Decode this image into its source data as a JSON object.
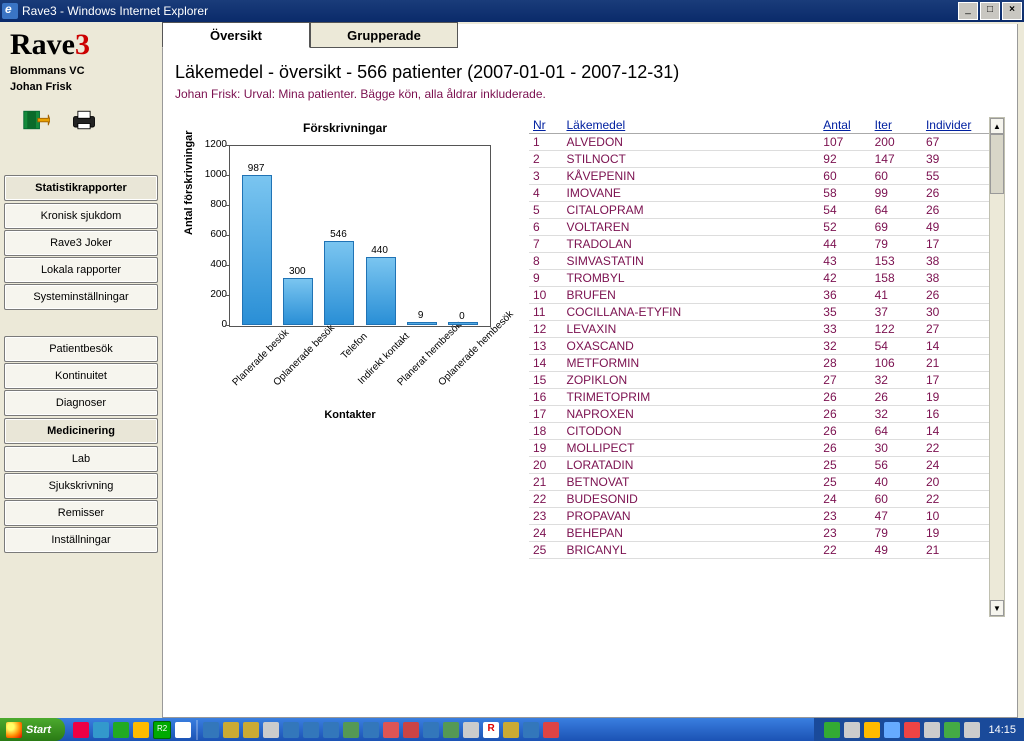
{
  "window": {
    "title": "Rave3 - Windows Internet Explorer"
  },
  "app": {
    "name_plain": "Rave",
    "name_accent": "3",
    "org": "Blommans VC",
    "user": "Johan Frisk"
  },
  "sidebar": {
    "section1_head": "Statistikrapporter",
    "section1": [
      "Kronisk sjukdom",
      "Rave3 Joker",
      "Lokala rapporter",
      "Systeminställningar"
    ],
    "section2": [
      "Patientbesök",
      "Kontinuitet",
      "Diagnoser"
    ],
    "section2_active": "Medicinering",
    "section3": [
      "Lab",
      "Sjukskrivning",
      "Remisser",
      "Inställningar"
    ]
  },
  "tabs": {
    "active": "Översikt",
    "other": "Grupperade"
  },
  "header": {
    "title": "Läkemedel - översikt - 566 patienter (2007-01-01 - 2007-12-31)",
    "subtitle": "Johan Frisk: Urval: Mina patienter. Bägge kön, alla åldrar inkluderade."
  },
  "chart_title": "Förskrivningar",
  "chart_data": {
    "type": "bar",
    "title": "Förskrivningar",
    "xlabel": "Kontakter",
    "ylabel": "Antal förskrivningar",
    "ylim": [
      0,
      1200
    ],
    "yticks": [
      0,
      200,
      400,
      600,
      800,
      1000,
      1200
    ],
    "categories": [
      "Planerade besök",
      "Oplanerade besök",
      "Telefon",
      "Indirekt kontakt",
      "Planerat hembesök",
      "Oplanerade hembesök"
    ],
    "values": [
      987,
      300,
      546,
      440,
      9,
      0
    ]
  },
  "table": {
    "headers": {
      "nr": "Nr",
      "name": "Läkemedel",
      "antal": "Antal",
      "iter": "Iter",
      "ind": "Individer"
    },
    "rows": [
      {
        "nr": 1,
        "name": "ALVEDON",
        "antal": 107,
        "iter": 200,
        "ind": 67
      },
      {
        "nr": 2,
        "name": "STILNOCT",
        "antal": 92,
        "iter": 147,
        "ind": 39
      },
      {
        "nr": 3,
        "name": "KÅVEPENIN",
        "antal": 60,
        "iter": 60,
        "ind": 55
      },
      {
        "nr": 4,
        "name": "IMOVANE",
        "antal": 58,
        "iter": 99,
        "ind": 26
      },
      {
        "nr": 5,
        "name": "CITALOPRAM",
        "antal": 54,
        "iter": 64,
        "ind": 26
      },
      {
        "nr": 6,
        "name": "VOLTAREN",
        "antal": 52,
        "iter": 69,
        "ind": 49
      },
      {
        "nr": 7,
        "name": "TRADOLAN",
        "antal": 44,
        "iter": 79,
        "ind": 17
      },
      {
        "nr": 8,
        "name": "SIMVASTATIN",
        "antal": 43,
        "iter": 153,
        "ind": 38
      },
      {
        "nr": 9,
        "name": "TROMBYL",
        "antal": 42,
        "iter": 158,
        "ind": 38
      },
      {
        "nr": 10,
        "name": "BRUFEN",
        "antal": 36,
        "iter": 41,
        "ind": 26
      },
      {
        "nr": 11,
        "name": "COCILLANA-ETYFIN",
        "antal": 35,
        "iter": 37,
        "ind": 30
      },
      {
        "nr": 12,
        "name": "LEVAXIN",
        "antal": 33,
        "iter": 122,
        "ind": 27
      },
      {
        "nr": 13,
        "name": "OXASCAND",
        "antal": 32,
        "iter": 54,
        "ind": 14
      },
      {
        "nr": 14,
        "name": "METFORMIN",
        "antal": 28,
        "iter": 106,
        "ind": 21
      },
      {
        "nr": 15,
        "name": "ZOPIKLON",
        "antal": 27,
        "iter": 32,
        "ind": 17
      },
      {
        "nr": 16,
        "name": "TRIMETOPRIM",
        "antal": 26,
        "iter": 26,
        "ind": 19
      },
      {
        "nr": 17,
        "name": "NAPROXEN",
        "antal": 26,
        "iter": 32,
        "ind": 16
      },
      {
        "nr": 18,
        "name": "CITODON",
        "antal": 26,
        "iter": 64,
        "ind": 14
      },
      {
        "nr": 19,
        "name": "MOLLIPECT",
        "antal": 26,
        "iter": 30,
        "ind": 22
      },
      {
        "nr": 20,
        "name": "LORATADIN",
        "antal": 25,
        "iter": 56,
        "ind": 24
      },
      {
        "nr": 21,
        "name": "BETNOVAT",
        "antal": 25,
        "iter": 40,
        "ind": 20
      },
      {
        "nr": 22,
        "name": "BUDESONID",
        "antal": 24,
        "iter": 60,
        "ind": 22
      },
      {
        "nr": 23,
        "name": "PROPAVAN",
        "antal": 23,
        "iter": 47,
        "ind": 10
      },
      {
        "nr": 24,
        "name": "BEHEPAN",
        "antal": 23,
        "iter": 79,
        "ind": 19
      },
      {
        "nr": 25,
        "name": "BRICANYL",
        "antal": 22,
        "iter": 49,
        "ind": 21
      }
    ]
  },
  "taskbar": {
    "start": "Start",
    "clock": "14:15"
  }
}
